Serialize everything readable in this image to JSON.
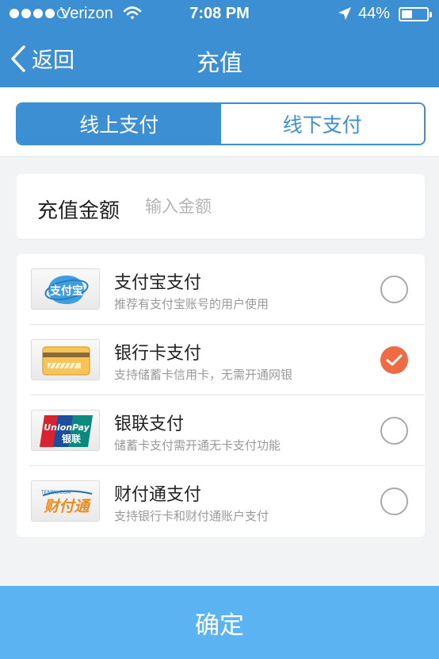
{
  "status_bar": {
    "carrier": "Verizon",
    "time": "7:08 PM",
    "battery": "44%",
    "battery_level": 0.44,
    "icons": [
      "signal-dots-icon",
      "wifi-icon",
      "location-arrow-icon",
      "battery-icon"
    ]
  },
  "nav": {
    "back_label": "返回",
    "title": "充值",
    "back_icon": "chevron-left-icon"
  },
  "tabs": [
    {
      "label": "线上支付",
      "selected": true
    },
    {
      "label": "线下支付",
      "selected": false
    }
  ],
  "amount": {
    "label": "充值金额",
    "placeholder": "输入金额",
    "value": ""
  },
  "payment_methods": [
    {
      "name": "支付宝支付",
      "desc": "推荐有支付宝账号的用户使用",
      "logo": "alipay-logo",
      "selected": false
    },
    {
      "name": "银行卡支付",
      "desc": "支持储蓄卡信用卡，无需开通网银",
      "logo": "bank-card-logo",
      "selected": true
    },
    {
      "name": "银联支付",
      "desc": "储蓄卡支付需开通无卡支付功能",
      "logo": "unionpay-logo",
      "selected": false
    },
    {
      "name": "财付通支付",
      "desc": "支持银行卡和财付通账户支付",
      "logo": "tenpay-logo",
      "selected": false
    }
  ],
  "logos": {
    "alipay": "支付宝",
    "unionpay_top": "UnionPay",
    "unionpay_bottom": "银联",
    "tenpay_small": "TENPAY.COM",
    "tenpay": "财付通"
  },
  "confirm_label": "确定",
  "colors": {
    "nav_blue": "#3d8fd3",
    "confirm_blue": "#5cb3f1",
    "check_orange": "#ef6b46",
    "background": "#f2f3f5"
  }
}
